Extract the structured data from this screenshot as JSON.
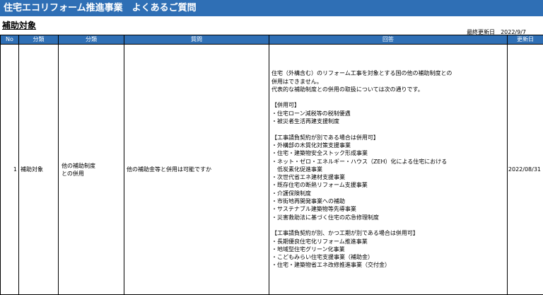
{
  "banner_title": "住宅エコリフォーム推進事業　よくあるご質問",
  "section_title": "補助対象",
  "last_updated": {
    "label": "最終更新日",
    "date": "2022/9/7"
  },
  "columns": [
    "No",
    "分類",
    "分類",
    "質問",
    "回答",
    "更新日"
  ],
  "row": {
    "no": "1",
    "category1": "補助対象",
    "category2_lines": [
      "他の補助制度",
      "との併用"
    ],
    "question": "他の補助金等と併用は可能ですか",
    "answer_lines": [
      "住宅（外構含む）のリフォーム工事を対象とする国の他の補助制度との",
      "併用はできません。",
      "代表的な補助制度との併用の取扱については次の通りです。",
      "",
      "【併用可】",
      "・住宅ローン減税等の税制優遇",
      "・被災者生活再建支援制度",
      "",
      "【工事請負契約が別である場合は併用可】",
      "・外構部の木質化対策支援事業",
      "・住宅・建築物安全ストック形成事業",
      "・ネット・ゼロ・エネルギー・ハウス（ZEH）化による住宅における",
      "　低炭素化促進事業",
      "・次世代省エネ建材支援事業",
      "・既存住宅の断熱リフォーム支援事業",
      "・介護保険制度",
      "・市街地再開発事業への補助",
      "・サステナブル建築物等先導事業",
      "・災害救助法に基づく住宅の応急修理制度",
      "",
      "【工事請負契約が別、かつ工期が別である場合は併用可】",
      "・長期優良住宅化リフォーム推進事業",
      "・地域型住宅グリーン化事業",
      "・こどもみらい住宅支援事業（補助金）",
      "・住宅・建築物省エネ改修推進事業（交付金）"
    ],
    "updated": "2022/08/31"
  }
}
